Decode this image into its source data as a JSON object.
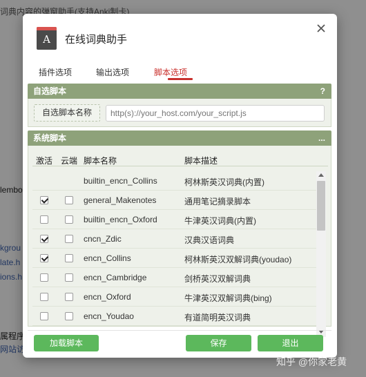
{
  "background": {
    "top_text": "词典内容的弹窗助手(支持Anki制卡)",
    "left_fragments": [
      "lembo",
      "kgrou",
      "late.h",
      "ions.h",
      "网站访"
    ],
    "left_dark_fragment": "属程序"
  },
  "dialog": {
    "title": "在线词典助手",
    "app_icon_letter": "A",
    "close_label": "×"
  },
  "tabs": [
    {
      "label": "插件选项"
    },
    {
      "label": "输出选项"
    },
    {
      "label": "脚本选项",
      "active": true
    }
  ],
  "custom_scripts": {
    "header": "自选脚本",
    "help_label": "?",
    "name_button": "自选脚本名称",
    "url_placeholder": "http(s)://your_host.com/your_script.js",
    "url_value": ""
  },
  "system_scripts": {
    "header": "系统脚本",
    "more_label": "...",
    "columns": {
      "active": "激活",
      "cloud": "云端",
      "name": "脚本名称",
      "desc": "脚本描述"
    },
    "rows": [
      {
        "name": "builtin_encn_Collins",
        "desc": "柯林斯英汉词典(内置)",
        "active": null,
        "cloud": null
      },
      {
        "name": "general_Makenotes",
        "desc": "通用笔记摘录脚本",
        "active": true,
        "cloud": false
      },
      {
        "name": "builtin_encn_Oxford",
        "desc": "牛津英汉词典(内置)",
        "active": false,
        "cloud": false
      },
      {
        "name": "cncn_Zdic",
        "desc": "汉典汉语词典",
        "active": true,
        "cloud": false
      },
      {
        "name": "encn_Collins",
        "desc": "柯林斯英汉双解词典(youdao)",
        "active": true,
        "cloud": false
      },
      {
        "name": "encn_Cambridge",
        "desc": "剑桥英汉双解词典",
        "active": false,
        "cloud": false
      },
      {
        "name": "encn_Oxford",
        "desc": "牛津英汉双解词典(bing)",
        "active": false,
        "cloud": false
      },
      {
        "name": "encn_Youdao",
        "desc": "有道简明英汉词典",
        "active": false,
        "cloud": false
      }
    ]
  },
  "footer": {
    "load_button": "加载脚本",
    "save_button": "保存",
    "exit_button": "退出"
  },
  "watermark": "知乎 @你家老黄",
  "colors": {
    "accent": "#c9302c",
    "panel_header": "#8ea27a",
    "button_green": "#5cb85c"
  }
}
